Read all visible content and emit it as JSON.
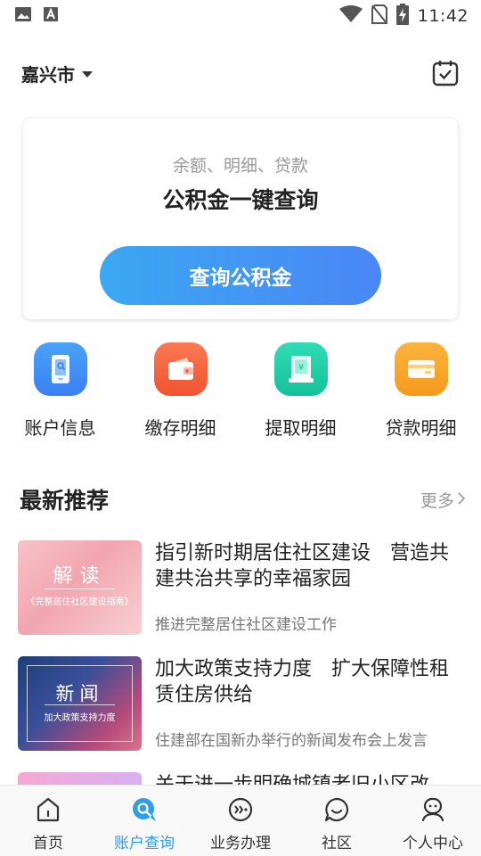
{
  "status_bar": {
    "time": "11:42",
    "icons": [
      "image-icon",
      "text-a-icon",
      "wifi-icon",
      "no-sim-icon",
      "battery-charging-icon"
    ]
  },
  "header": {
    "city": "嘉兴市",
    "right_icon": "checklist-icon"
  },
  "query_card": {
    "subtitle": "余额、明细、贷款",
    "title": "公积金一键查询",
    "button_label": "查询公积金",
    "button_gradient": [
      "#3aa8f2",
      "#4a86f5"
    ]
  },
  "services": [
    {
      "label": "账户信息",
      "icon": "phone-account-icon",
      "color": "#3d8ff5"
    },
    {
      "label": "缴存明细",
      "icon": "wallet-icon",
      "color": "#f5603d"
    },
    {
      "label": "提取明细",
      "icon": "yuan-withdraw-icon",
      "color": "#1fcfa8"
    },
    {
      "label": "贷款明细",
      "icon": "card-icon",
      "color": "#f8a72b"
    }
  ],
  "recommend": {
    "title": "最新推荐",
    "more_label": "更多",
    "items": [
      {
        "title": "指引新时期居住社区建设　营造共建共治共享的幸福家园",
        "summary": "推进完整居住社区建设工作",
        "thumb_title": "解读",
        "thumb_sub": "《完整居住社区建设指南》"
      },
      {
        "title": "加大政策支持力度　扩大保障性租赁住房供给",
        "summary": "住建部在国新办举行的新闻发布会上发言",
        "thumb_title": "新闻",
        "thumb_sub": "加大政策支持力度"
      },
      {
        "title": "关于进一步明确城镇老旧小区改",
        "summary": ""
      }
    ]
  },
  "bottom_nav": {
    "active_color": "#2f9cf0",
    "items": [
      {
        "label": "首页",
        "icon": "home-icon"
      },
      {
        "label": "账户查询",
        "icon": "search-bubble-icon",
        "active": true
      },
      {
        "label": "业务办理",
        "icon": "business-icon"
      },
      {
        "label": "社区",
        "icon": "chat-icon"
      },
      {
        "label": "个人中心",
        "icon": "profile-icon"
      }
    ]
  }
}
